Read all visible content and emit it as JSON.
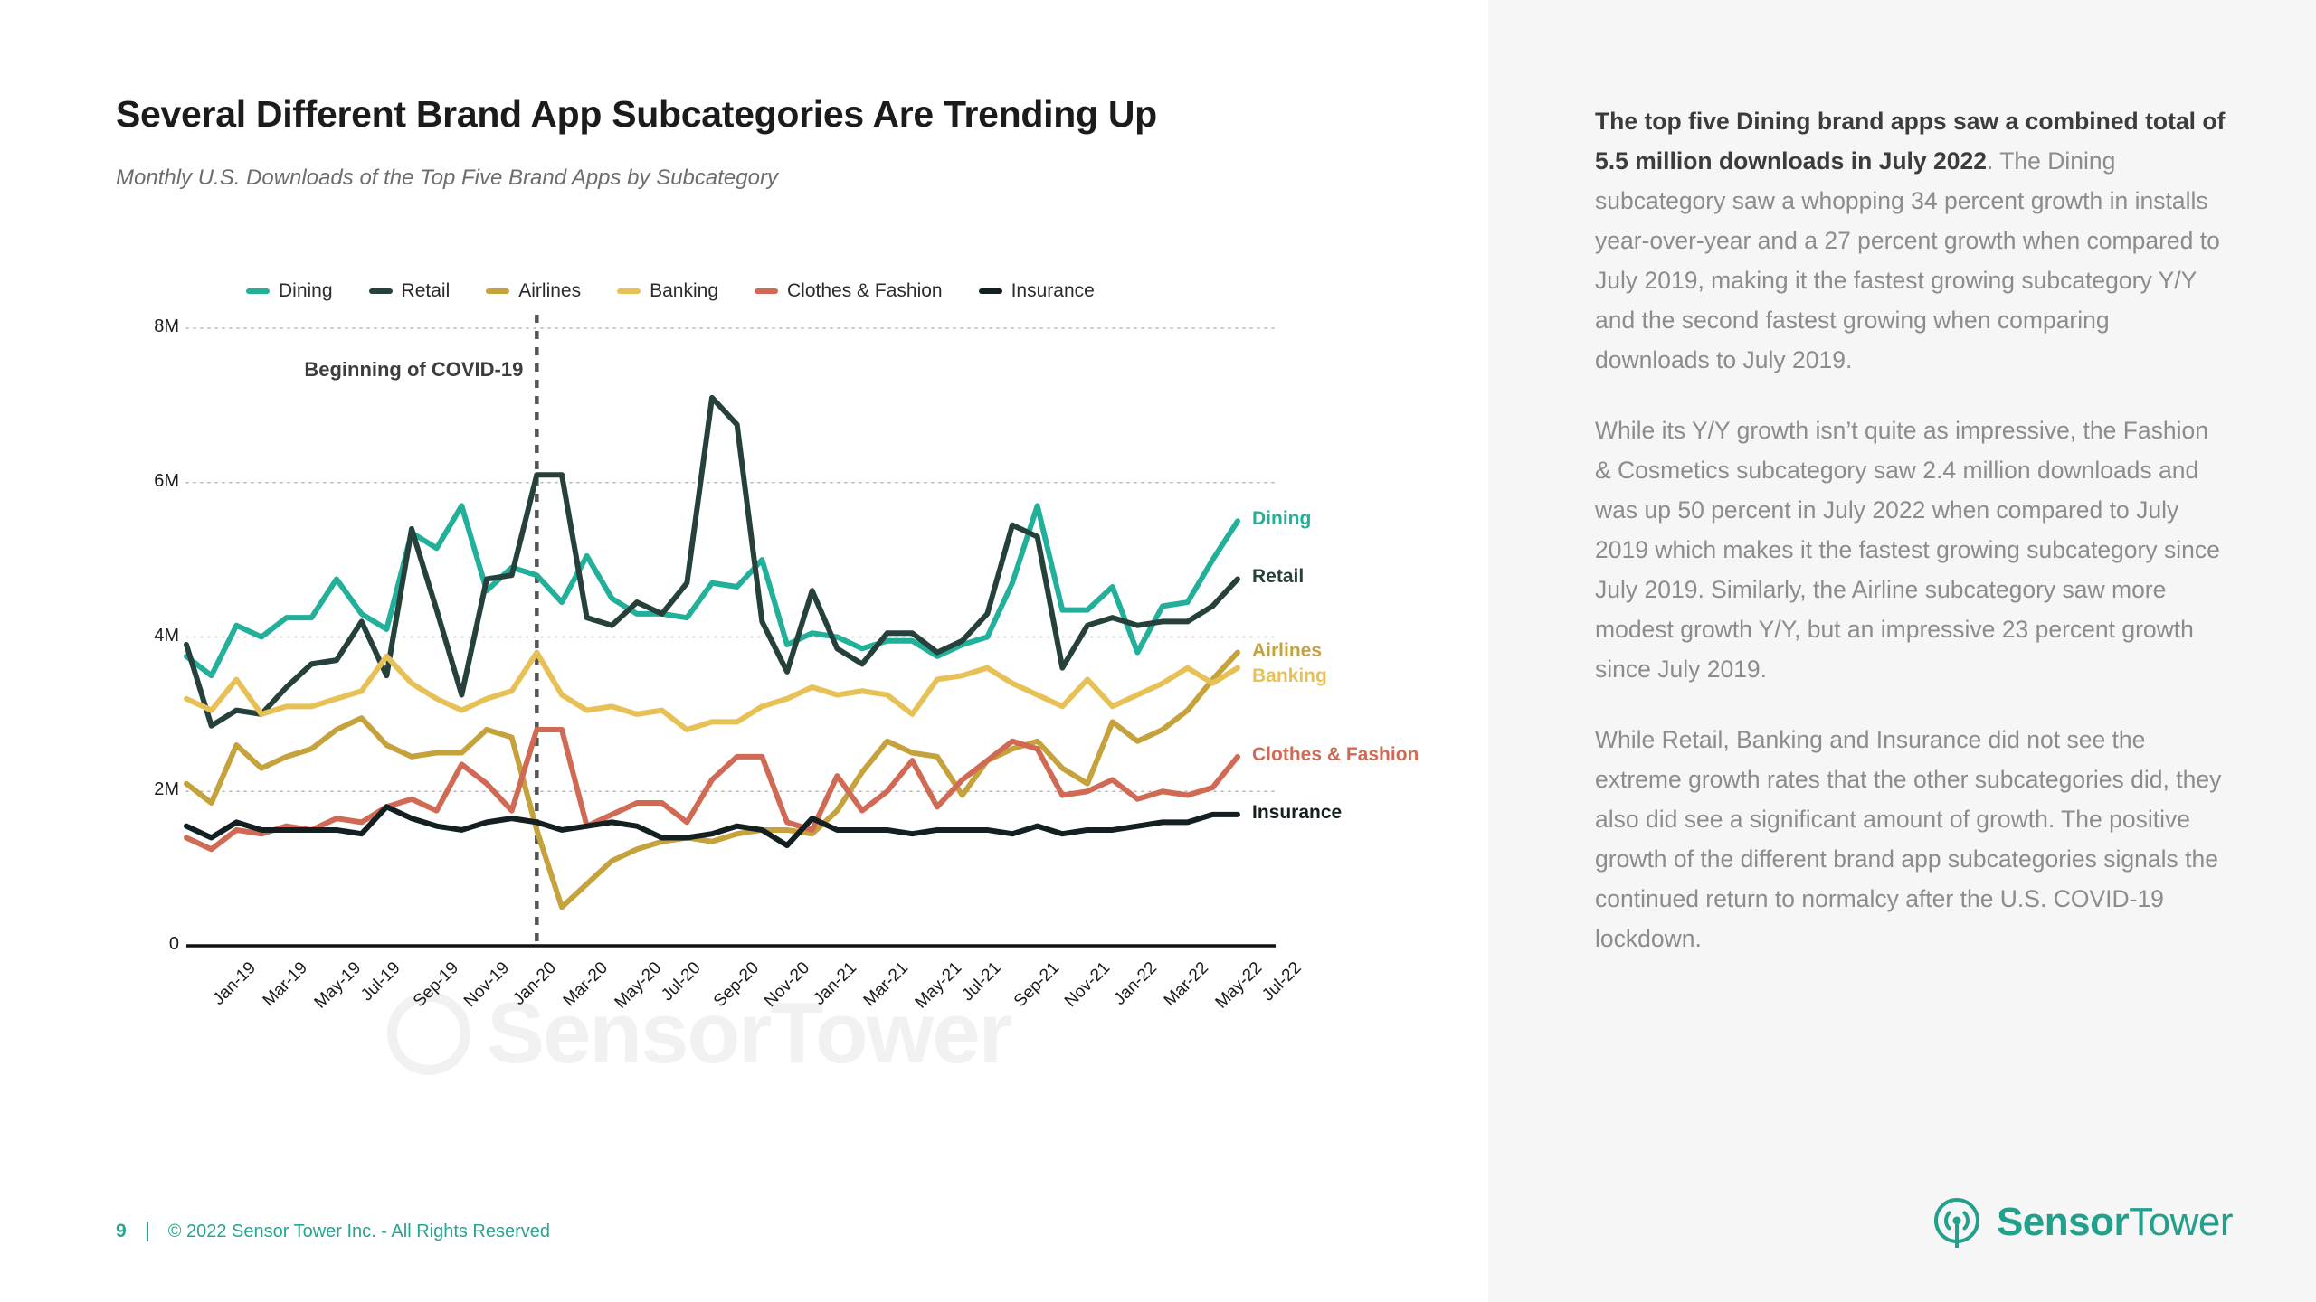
{
  "slide": {
    "title": "Several Different Brand App Subcategories Are Trending Up",
    "subtitle": "Monthly U.S. Downloads of the Top Five Brand Apps by Subcategory"
  },
  "footer": {
    "page_number": "9",
    "copyright": "© 2022 Sensor Tower Inc. - All Rights Reserved"
  },
  "logo": {
    "bold": "Sensor",
    "light": "Tower",
    "icon": "sensor-tower-antenna-icon"
  },
  "watermark": {
    "text": "SensorTower"
  },
  "panel": {
    "paragraphs": [
      {
        "bold": "The top five Dining brand apps saw a combined total of 5.5 million downloads in July 2022",
        "rest": ". The Dining subcategory saw a whopping 34 percent growth in installs year-over-year and a 27 percent growth when compared to July 2019, making it the fastest growing subcategory Y/Y and the second fastest growing when comparing downloads to July 2019."
      },
      {
        "bold": "",
        "rest": "While its Y/Y growth isn’t quite as impressive, the Fashion & Cosmetics subcategory saw 2.4 million downloads and was up 50 percent in July 2022 when compared to July 2019 which makes it the fastest growing subcategory since July 2019. Similarly, the Airline subcategory saw more modest growth Y/Y, but an impressive 23 percent growth since July 2019."
      },
      {
        "bold": "",
        "rest": "While Retail, Banking and Insurance did not see the extreme growth rates that the other subcategories did, they also did see a significant amount of growth. The positive growth of the different brand app subcategories signals the continued return to normalcy after the U.S. COVID-19 lockdown."
      }
    ]
  },
  "chart_data": {
    "type": "line",
    "title": "Several Different Brand App Subcategories Are Trending Up",
    "subtitle": "Monthly U.S. Downloads of the Top Five Brand Apps by Subcategory",
    "xlabel": "",
    "ylabel": "",
    "ylim": [
      0,
      8000000
    ],
    "ytick_values": [
      0,
      2000000,
      4000000,
      6000000,
      8000000
    ],
    "ytick_labels": [
      "0",
      "2M",
      "4M",
      "6M",
      "8M"
    ],
    "grid": true,
    "legend_position": "top",
    "annotation": {
      "text": "Beginning of COVID-19",
      "at_x": "Mar-20"
    },
    "x": [
      "Jan-19",
      "Feb-19",
      "Mar-19",
      "Apr-19",
      "May-19",
      "Jun-19",
      "Jul-19",
      "Aug-19",
      "Sep-19",
      "Oct-19",
      "Nov-19",
      "Dec-19",
      "Jan-20",
      "Feb-20",
      "Mar-20",
      "Apr-20",
      "May-20",
      "Jun-20",
      "Jul-20",
      "Aug-20",
      "Sep-20",
      "Oct-20",
      "Nov-20",
      "Dec-20",
      "Jan-21",
      "Feb-21",
      "Mar-21",
      "Apr-21",
      "May-21",
      "Jun-21",
      "Jul-21",
      "Aug-21",
      "Sep-21",
      "Oct-21",
      "Nov-21",
      "Dec-21",
      "Jan-22",
      "Feb-22",
      "Mar-22",
      "Apr-22",
      "May-22",
      "Jun-22",
      "Jul-22"
    ],
    "xtick_labels": [
      "Jan-19",
      "Mar-19",
      "May-19",
      "Jul-19",
      "Sep-19",
      "Nov-19",
      "Jan-20",
      "Mar-20",
      "May-20",
      "Jul-20",
      "Sep-20",
      "Nov-20",
      "Jan-21",
      "Mar-21",
      "May-21",
      "Jul-21",
      "Sep-21",
      "Nov-21",
      "Jan-22",
      "Mar-22",
      "May-22",
      "Jul-22"
    ],
    "series": [
      {
        "name": "Dining",
        "color": "#22b09a",
        "end_label": "Dining",
        "values": [
          3750000,
          3500000,
          4150000,
          4000000,
          4250000,
          4250000,
          4750000,
          4300000,
          4100000,
          5350000,
          5150000,
          5700000,
          4600000,
          4900000,
          4800000,
          4450000,
          5050000,
          4500000,
          4300000,
          4300000,
          4250000,
          4700000,
          4650000,
          5000000,
          3900000,
          4050000,
          4000000,
          3850000,
          3950000,
          3950000,
          3750000,
          3900000,
          4000000,
          4700000,
          5700000,
          4350000,
          4350000,
          4650000,
          3800000,
          4400000,
          4450000,
          5000000,
          5500000
        ]
      },
      {
        "name": "Retail",
        "color": "#26413c",
        "end_label": "Retail",
        "values": [
          3900000,
          2850000,
          3050000,
          3000000,
          3350000,
          3650000,
          3700000,
          4200000,
          3500000,
          5400000,
          4350000,
          3250000,
          4750000,
          4800000,
          6100000,
          6100000,
          4250000,
          4150000,
          4450000,
          4300000,
          4700000,
          7100000,
          6750000,
          4200000,
          3550000,
          4600000,
          3850000,
          3650000,
          4050000,
          4050000,
          3800000,
          3950000,
          4300000,
          5450000,
          5300000,
          3600000,
          4150000,
          4250000,
          4150000,
          4200000,
          4200000,
          4400000,
          4750000
        ]
      },
      {
        "name": "Airlines",
        "color": "#c5a23c",
        "end_label": "Airlines",
        "values": [
          2100000,
          1850000,
          2600000,
          2300000,
          2450000,
          2550000,
          2800000,
          2950000,
          2600000,
          2450000,
          2500000,
          2500000,
          2800000,
          2700000,
          1500000,
          500000,
          800000,
          1100000,
          1250000,
          1350000,
          1400000,
          1350000,
          1450000,
          1500000,
          1500000,
          1450000,
          1750000,
          2250000,
          2650000,
          2500000,
          2450000,
          1950000,
          2400000,
          2550000,
          2650000,
          2300000,
          2100000,
          2900000,
          2650000,
          2800000,
          3050000,
          3450000,
          3800000
        ]
      },
      {
        "name": "Banking",
        "color": "#e8c156",
        "end_label": "Banking",
        "values": [
          3200000,
          3050000,
          3450000,
          3000000,
          3100000,
          3100000,
          3200000,
          3300000,
          3750000,
          3400000,
          3200000,
          3050000,
          3200000,
          3300000,
          3800000,
          3250000,
          3050000,
          3100000,
          3000000,
          3050000,
          2800000,
          2900000,
          2900000,
          3100000,
          3200000,
          3350000,
          3250000,
          3300000,
          3250000,
          3000000,
          3450000,
          3500000,
          3600000,
          3400000,
          3250000,
          3100000,
          3450000,
          3100000,
          3250000,
          3400000,
          3600000,
          3400000,
          3600000
        ]
      },
      {
        "name": "Clothes & Fashion",
        "color": "#d06a55",
        "end_label": "Clothes & Fashion",
        "values": [
          1400000,
          1250000,
          1500000,
          1450000,
          1550000,
          1500000,
          1650000,
          1600000,
          1800000,
          1900000,
          1750000,
          2350000,
          2100000,
          1750000,
          2800000,
          2800000,
          1550000,
          1700000,
          1850000,
          1850000,
          1600000,
          2150000,
          2450000,
          2450000,
          1600000,
          1500000,
          2200000,
          1750000,
          2000000,
          2400000,
          1800000,
          2150000,
          2400000,
          2650000,
          2550000,
          1950000,
          2000000,
          2150000,
          1900000,
          2000000,
          1950000,
          2050000,
          2450000
        ]
      },
      {
        "name": "Insurance",
        "color": "#131f20",
        "end_label": "Insurance",
        "values": [
          1550000,
          1400000,
          1600000,
          1500000,
          1500000,
          1500000,
          1500000,
          1450000,
          1800000,
          1650000,
          1550000,
          1500000,
          1600000,
          1650000,
          1600000,
          1500000,
          1550000,
          1600000,
          1550000,
          1400000,
          1400000,
          1450000,
          1550000,
          1500000,
          1300000,
          1650000,
          1500000,
          1500000,
          1500000,
          1450000,
          1500000,
          1500000,
          1500000,
          1450000,
          1550000,
          1450000,
          1500000,
          1500000,
          1550000,
          1600000,
          1600000,
          1700000,
          1700000
        ]
      }
    ]
  }
}
